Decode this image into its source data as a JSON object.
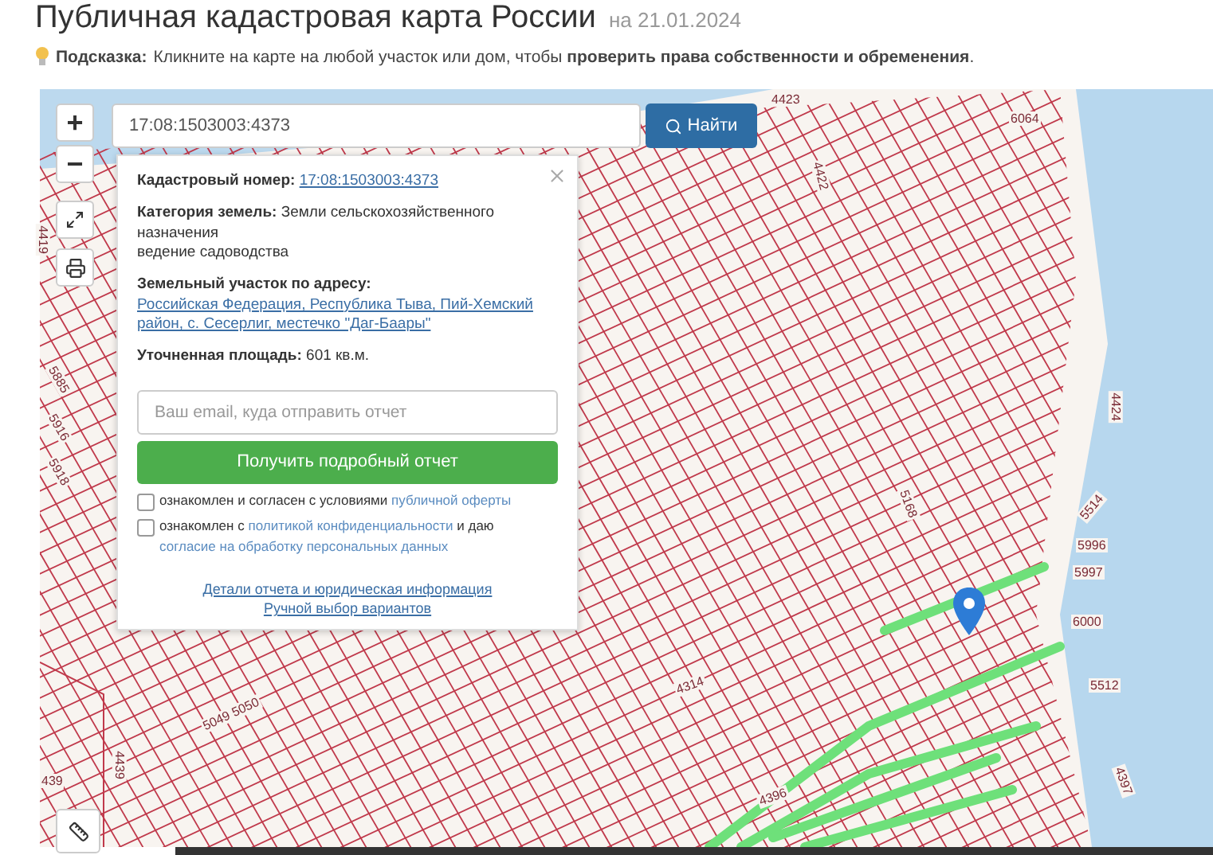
{
  "header": {
    "title": "Публичная кадастровая карта России",
    "date": "на 21.01.2024"
  },
  "hint": {
    "label": "Подсказка:",
    "text": "Кликните на карте на любой участок или дом, чтобы **проверить права собственности и обременения**."
  },
  "search": {
    "value": "17:08:1503003:4373",
    "button": "Найти"
  },
  "zoom": {
    "in": "+",
    "out": "−"
  },
  "popup": {
    "fields": [
      {
        "label": "Кадастровый номер:",
        "value": "17:08:1503003:4373",
        "kind": "link"
      },
      {
        "label": "Категория земель:",
        "value": "Земли сельскохозяйственного назначения",
        "extra": "ведение садоводства",
        "kind": "text"
      },
      {
        "label": "Земельный участок по адресу:",
        "value": "Российская Федерация, Республика Тыва, Пий-Хемский район, с. Сесерлиг, местечко \"Даг-Баары\"",
        "kind": "link"
      },
      {
        "label": "Уточненная площадь:",
        "value": "601 кв.м.",
        "kind": "text"
      }
    ],
    "email": {
      "placeholder": "Ваш email, куда отправить отчет"
    },
    "submit": "Получить подробный отчет",
    "agreements": [
      {
        "before": "ознакомлен и согласен с условиями",
        "link": "публичной оферты",
        "checked": false
      },
      {
        "before": "ознакомлен с",
        "link": "политикой конфиденциальности",
        "after": "и даю",
        "link2": "согласие на обработку персональных данных",
        "checked": false
      }
    ],
    "links": [
      "Детали отчета и юридическая информация",
      "Ручной выбор вариантов"
    ]
  },
  "map_labels": [
    "4423",
    "6064",
    "4422",
    "4424",
    "4419",
    "5885",
    "5916",
    "5918",
    "5168",
    "5514",
    "5996",
    "5997",
    "6000",
    "5512",
    "4314",
    "4396",
    "4397",
    "5049 5050",
    "4439",
    "439"
  ]
}
